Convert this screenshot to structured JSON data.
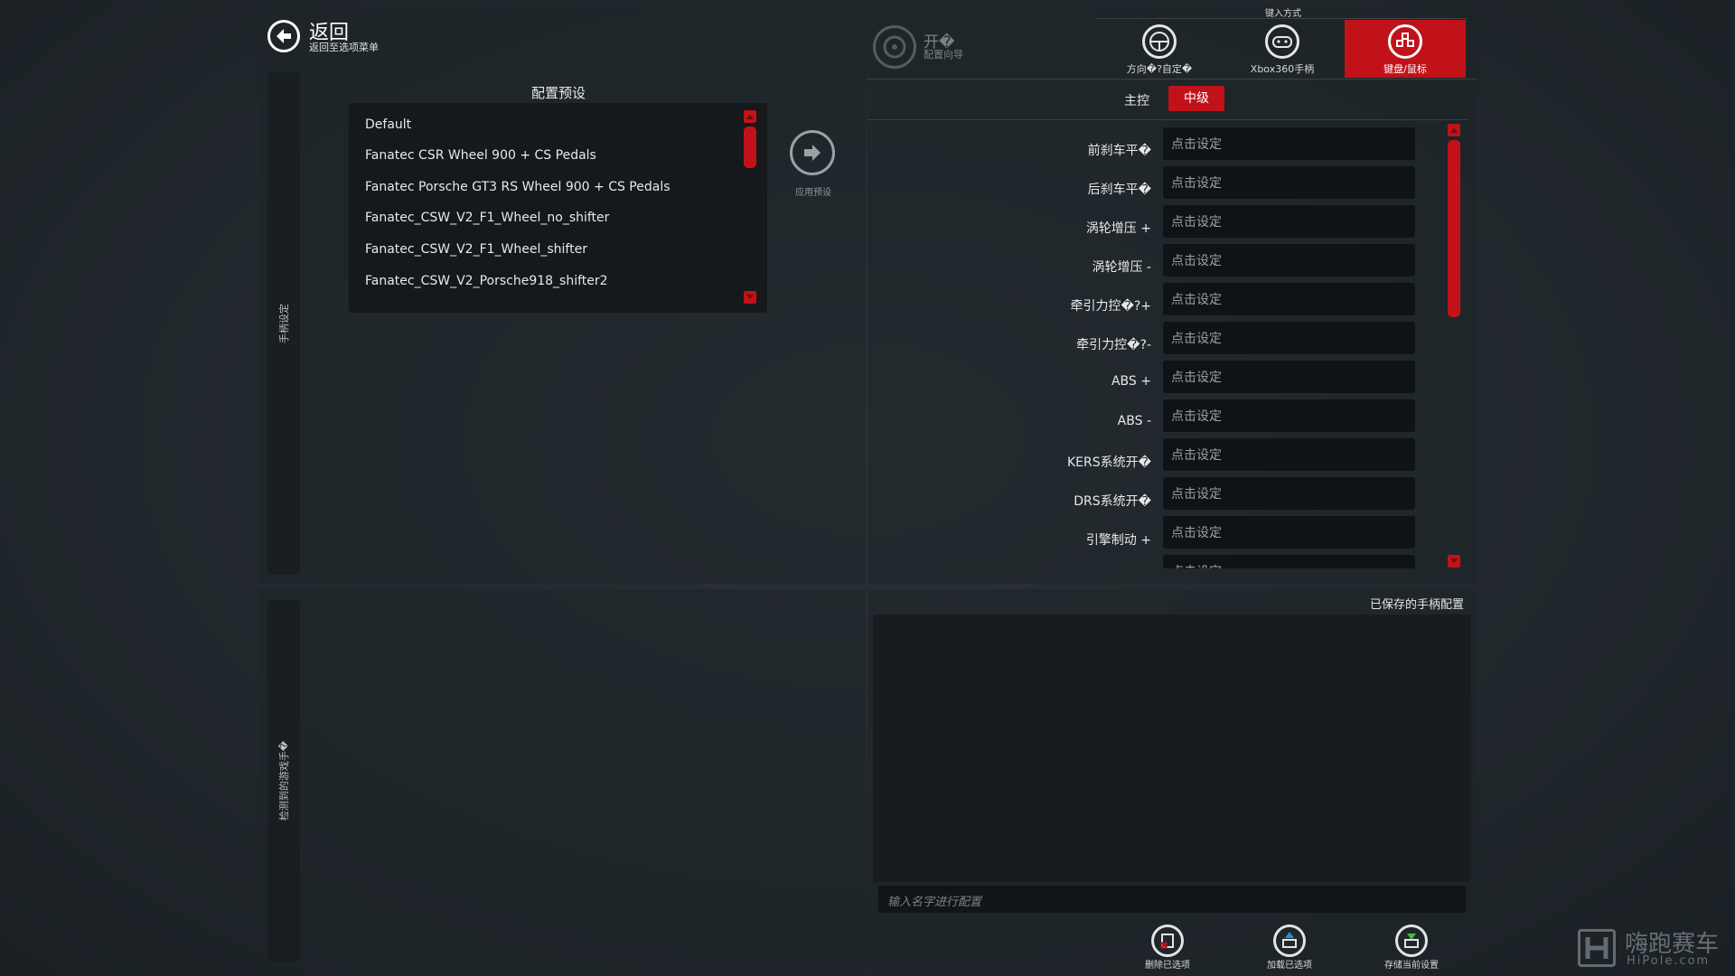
{
  "header": {
    "back_title": "返回",
    "back_subtitle": "返回至选项菜单",
    "wizard_title": "开�",
    "wizard_subtitle": "配置向导"
  },
  "side": {
    "top_label": "手柄设定",
    "bottom_label": "检测到的游戏手�"
  },
  "presets": {
    "title": "配置预设",
    "items": [
      "Default",
      "Fanatec CSR Wheel 900 + CS Pedals",
      "Fanatec Porsche GT3 RS Wheel 900 + CS Pedals",
      "Fanatec_CSW_V2_F1_Wheel_no_shifter",
      "Fanatec_CSW_V2_F1_Wheel_shifter",
      "Fanatec_CSW_V2_Porsche918_shifter2"
    ],
    "apply_label": "应用预设"
  },
  "input_modes": {
    "title": "键入方式",
    "items": [
      {
        "label": "方向�?自定�",
        "icon": "steering-wheel-icon",
        "active": false
      },
      {
        "label": "Xbox360手柄",
        "icon": "gamepad-icon",
        "active": true
      },
      {
        "label": "键盘/鼠标",
        "icon": "keyboard-mouse-icon",
        "active": true
      }
    ],
    "active_color": "#c1121a"
  },
  "tabs": {
    "main": "主控",
    "intermediate": "中级"
  },
  "bindings": [
    {
      "label": "前刹车平�",
      "value": "点击设定"
    },
    {
      "label": "后刹车平�",
      "value": "点击设定"
    },
    {
      "label": "涡轮增压 +",
      "value": "点击设定"
    },
    {
      "label": "涡轮增压 -",
      "value": "点击设定"
    },
    {
      "label": "牵引力控�?+",
      "value": "点击设定"
    },
    {
      "label": "牵引力控�?-",
      "value": "点击设定"
    },
    {
      "label": "ABS +",
      "value": "点击设定"
    },
    {
      "label": "ABS -",
      "value": "点击设定"
    },
    {
      "label": "KERS系统开�",
      "value": "点击设定"
    },
    {
      "label": "DRS系统开�",
      "value": "点击设定"
    },
    {
      "label": "引擎制动 +",
      "value": "点击设定"
    },
    {
      "label": "",
      "value": "点击设定"
    }
  ],
  "saved": {
    "title": "已保存的手柄配置",
    "name_placeholder": "输入名字进行配置",
    "buttons": [
      {
        "label": "删除已选项",
        "icon": "delete-icon"
      },
      {
        "label": "加载已选项",
        "icon": "load-icon"
      },
      {
        "label": "存储当前设置",
        "icon": "save-icon"
      }
    ]
  },
  "watermark": {
    "cn": "嗨跑赛车",
    "en": "HiPole.com"
  }
}
